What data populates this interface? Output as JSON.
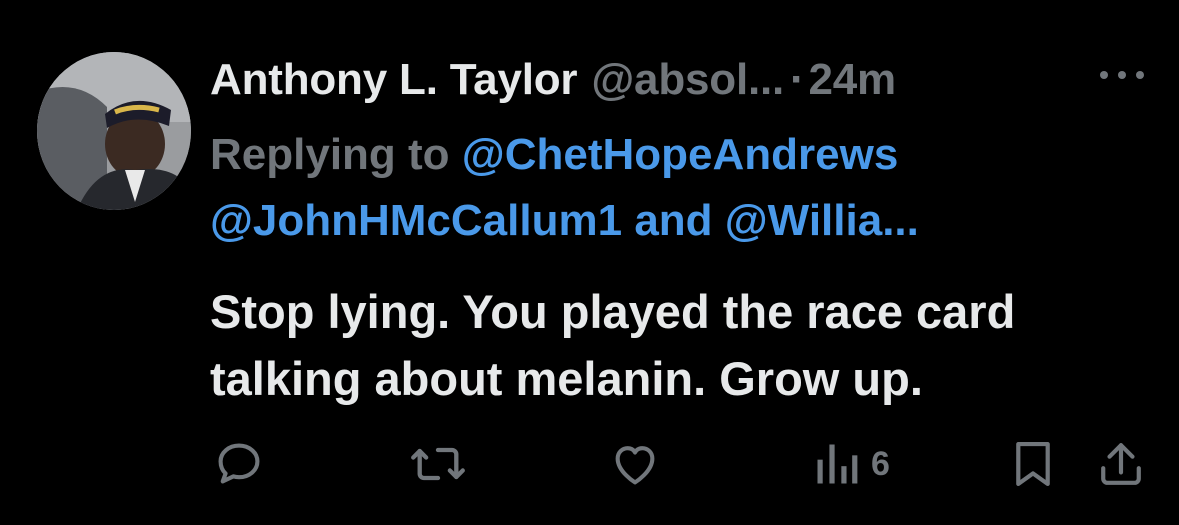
{
  "tweet": {
    "author_name": "Anthony L. Taylor",
    "handle": "@absol...",
    "separator": "·",
    "time": "24m",
    "replying_prefix": "Replying to",
    "replying_user1": "@ChetHopeAndrews",
    "replying_user2": "@JohnHMcCallum1",
    "replying_and": "and",
    "replying_user3": "@Willia...",
    "text_line1": "Stop lying. You played the race card",
    "text_line2": "talking about melanin. Grow up."
  },
  "actions": {
    "reply_icon": "comment-icon",
    "retweet_icon": "retweet-icon",
    "like_icon": "heart-icon",
    "views_icon": "views-chart-icon",
    "views_count": "6",
    "bookmark_icon": "bookmark-icon",
    "share_icon": "share-icon"
  },
  "colors": {
    "background": "#000000",
    "text_primary": "#e7e9ea",
    "text_secondary": "#71767b",
    "link": "#4a99e9"
  }
}
